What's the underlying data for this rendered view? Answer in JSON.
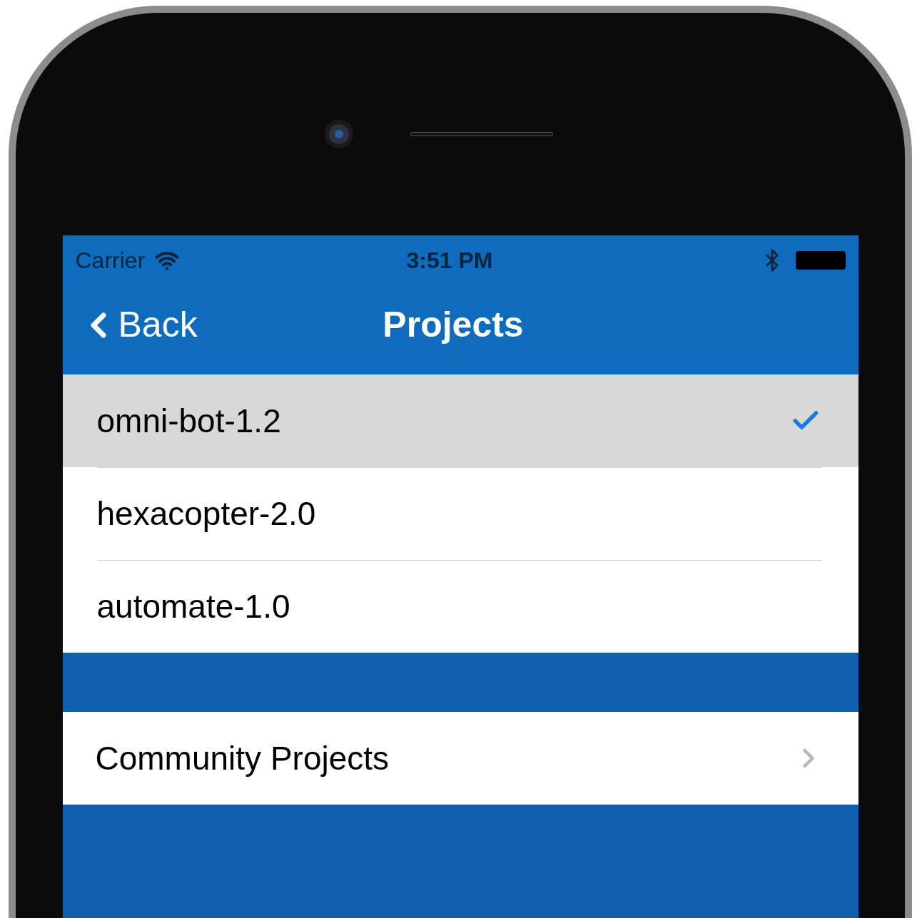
{
  "status_bar": {
    "carrier": "Carrier",
    "time": "3:51 PM"
  },
  "nav_bar": {
    "back": "Back",
    "title": "Projects"
  },
  "projects": [
    {
      "name": "omni-bot-1.2",
      "selected": true
    },
    {
      "name": "hexacopter-2.0",
      "selected": false
    },
    {
      "name": "automate-1.0",
      "selected": false
    }
  ],
  "community": {
    "label": "Community Projects"
  }
}
